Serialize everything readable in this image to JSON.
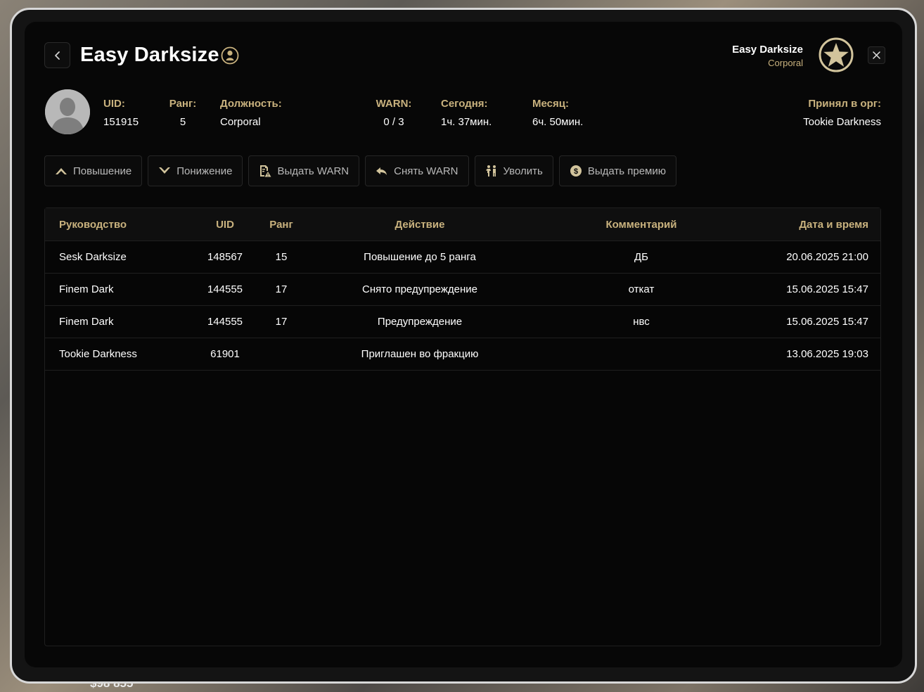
{
  "background": {
    "money": "$98 855"
  },
  "header": {
    "title": "Easy Darksize",
    "user_name": "Easy Darksize",
    "user_rank": "Corporal"
  },
  "stats": {
    "uid": {
      "label": "UID:",
      "value": "151915"
    },
    "rank": {
      "label": "Ранг:",
      "value": "5"
    },
    "position": {
      "label": "Должность:",
      "value": "Corporal"
    },
    "warn": {
      "label": "WARN:",
      "value": "0 / 3"
    },
    "today": {
      "label": "Сегодня:",
      "value": "1ч. 37мин."
    },
    "month": {
      "label": "Месяц:",
      "value": "6ч. 50мин."
    },
    "accepted": {
      "label": "Принял в орг:",
      "value": "Tookie Darkness"
    }
  },
  "actions": [
    {
      "label": "Повышение",
      "icon": "chevron-up-icon"
    },
    {
      "label": "Понижение",
      "icon": "chevron-down-icon"
    },
    {
      "label": "Выдать WARN",
      "icon": "warn-document-icon"
    },
    {
      "label": "Снять WARN",
      "icon": "undo-arrow-icon"
    },
    {
      "label": "Уволить",
      "icon": "fire-person-icon"
    },
    {
      "label": "Выдать премию",
      "icon": "money-coin-icon"
    }
  ],
  "table": {
    "headers": {
      "lead": "Руководство",
      "uid": "UID",
      "rank": "Ранг",
      "action": "Действие",
      "comment": "Комментарий",
      "date": "Дата и время"
    },
    "rows": [
      {
        "lead": "Sesk Darksize",
        "uid": "148567",
        "rank": "15",
        "action": "Повышение до 5 ранга",
        "comment": "ДБ",
        "date": "20.06.2025 21:00"
      },
      {
        "lead": "Finem Dark",
        "uid": "144555",
        "rank": "17",
        "action": "Снято предупреждение",
        "comment": "откат",
        "date": "15.06.2025 15:47"
      },
      {
        "lead": "Finem Dark",
        "uid": "144555",
        "rank": "17",
        "action": "Предупреждение",
        "comment": "нвс",
        "date": "15.06.2025 15:47"
      },
      {
        "lead": "Tookie Darkness",
        "uid": "61901",
        "rank": "",
        "action": "Приглашен во фракцию",
        "comment": "",
        "date": "13.06.2025 19:03"
      }
    ]
  },
  "colors": {
    "accent": "#c9b27e",
    "panel": "#070707",
    "text": "#ffffff"
  }
}
